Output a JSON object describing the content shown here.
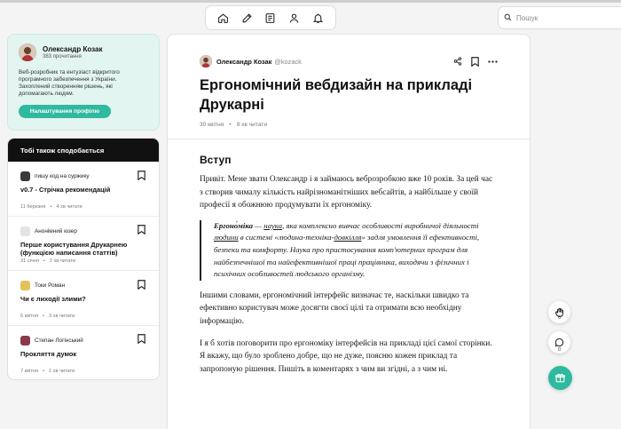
{
  "search": {
    "placeholder": "Пошук"
  },
  "nav": {
    "icons": [
      "home-icon",
      "edit-icon",
      "list-icon",
      "user-icon",
      "bell-icon"
    ]
  },
  "profile": {
    "name": "Олександр Козак",
    "followers": "383 прочитання",
    "bio": "Веб-розробник та ентузіаст відкритого програмного забезпечення з України. Захоплений створенням рішень, які допомагають людям.",
    "settings_label": "Налаштування профілю"
  },
  "recommendations": {
    "header": "Тобі також сподобається",
    "items": [
      {
        "author": "пишу код на суржику",
        "title": "v0.7 - Стрічка рекомендацій",
        "date": "11 березня",
        "read": "4 хв читати",
        "avatar_color": "#3a3a3a"
      },
      {
        "author": "Анонімний юзер",
        "title": "Перше користування Друкарнею (функцією написання статтів)",
        "date": "31 січня",
        "read": "2 хв читати",
        "avatar_color": "#e4e4e4"
      },
      {
        "author": "Токи Роман",
        "title": "Чи є лиходії злими?",
        "date": "6 квітня",
        "read": "3 хв читати",
        "avatar_color": "#e2c25a"
      },
      {
        "author": "Степан Логінський",
        "title": "Прокляття думок",
        "date": "7 квітня",
        "read": "1 хв читати",
        "avatar_color": "#8a3a4a"
      }
    ]
  },
  "article": {
    "author": "Олександр Козак",
    "handle": "@kozack",
    "title": "Ергономічний вебдизайн на прикладі Друкарні",
    "date": "30 квітня",
    "read": "9 хв читати",
    "section": "Вступ",
    "intro": "Привіт. Мене звати Олександр і я займаюсь веброзробкою вже 10 років. За цей час з створив чималу кількість найрізноманітніших вебсайтів, а найбільше у своїй професії я обожнюю продумувати їх ергономіку.",
    "quote": {
      "term": "Ергоно́міка",
      "dash": " — ",
      "link1": "наука",
      "text1": ", яка комплексно вивчає особливості виробничої діяльності ",
      "link2": "людини",
      "text2": " в системі «людина-техніка-",
      "link3": "довкілля",
      "text3": "» задля умовлення її ефективності, безпеки та комфорту. Наука про пристосування комп'ютерних програм для найбезпечнішої та найефективнішої праці працівника, виходячи з фізичних і психічних особливостей людського організму."
    },
    "para2": "Іншими словами, ергономічний інтерфейс визначає те, наскільки швидко та ефективно користувач може досягти своєї цілі та отримати всю необхідну інформацію.",
    "para3": "І я б хотів поговорити про ергономіку інтерфейсів на прикладі цієї самої сторінки. Я вкажу, що було зроблено добре, що не дуже, поясню кожен приклад та запропоную рішення. Пишіть в коментарях з чим ви згідні, а з чим ні."
  },
  "floating": {
    "reactions_count": "0",
    "comments_count": "0"
  }
}
